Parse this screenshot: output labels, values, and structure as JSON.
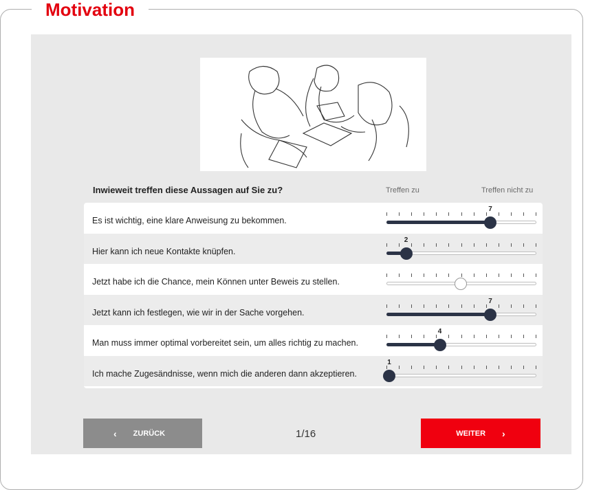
{
  "section_title": "Motivation",
  "question": "Inwieweit treffen diese Aussagen auf Sie zu?",
  "scale": {
    "left_label": "Treffen zu",
    "right_label": "Treffen nicht zu",
    "min": 1,
    "max": 7
  },
  "items": [
    {
      "text": "Es ist wichtig, eine klare Anweisung zu bekommen.",
      "value": 7,
      "value_label": "7",
      "answered": true,
      "alt": false
    },
    {
      "text": "Hier kann ich neue Kontakte knüpfen.",
      "value": 2,
      "value_label": "2",
      "answered": true,
      "alt": true
    },
    {
      "text": "Jetzt habe ich die Chance, mein Können unter Beweis zu stellen.",
      "value": null,
      "value_label": "",
      "answered": false,
      "alt": false
    },
    {
      "text": "Jetzt kann ich festlegen, wie wir in der Sache vorgehen.",
      "value": 7,
      "value_label": "7",
      "answered": true,
      "alt": true
    },
    {
      "text": "Man muss immer optimal vorbereitet sein, um alles richtig zu machen.",
      "value": 4,
      "value_label": "4",
      "answered": true,
      "alt": false
    },
    {
      "text": "Ich mache Zugesändnisse, wenn mich die anderen dann akzeptieren.",
      "value": 1,
      "value_label": "1",
      "answered": true,
      "alt": true
    }
  ],
  "nav": {
    "back_label": "ZURÜCK",
    "next_label": "WEITER",
    "page_indicator": "1/16"
  },
  "colors": {
    "accent_red": "#e3000f",
    "slider_dark": "#2b3346",
    "back_gray": "#8c8c8c"
  }
}
